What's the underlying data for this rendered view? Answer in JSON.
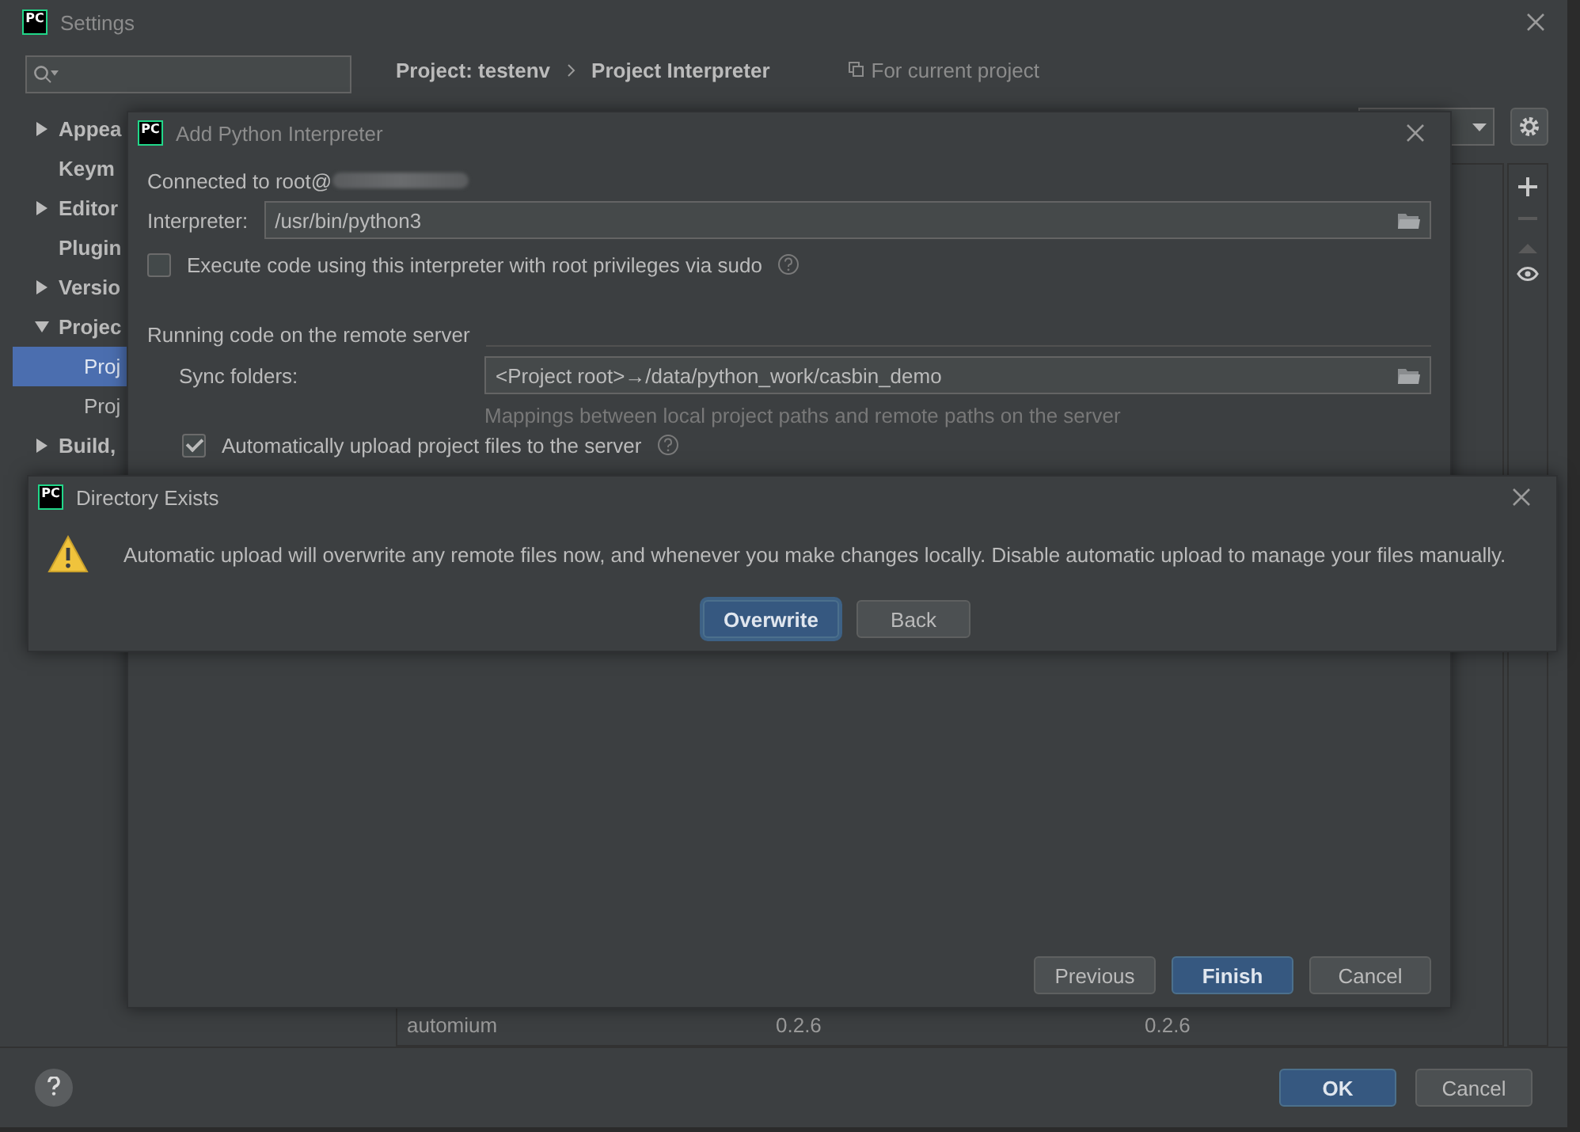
{
  "settings": {
    "logo": "PC",
    "title": "Settings",
    "breadcrumb": [
      "Project: testenv",
      "Project Interpreter"
    ],
    "scope_note": "For current project",
    "sidebar": {
      "items": [
        {
          "label": "Appea",
          "kind": "group",
          "expanded": false
        },
        {
          "label": "Keym",
          "kind": "leaf"
        },
        {
          "label": "Editor",
          "kind": "group",
          "expanded": false
        },
        {
          "label": "Plugin",
          "kind": "leaf"
        },
        {
          "label": "Versio",
          "kind": "group",
          "expanded": false
        },
        {
          "label": "Projec",
          "kind": "group",
          "expanded": true,
          "children": [
            {
              "label": "Proj",
              "selected": true
            },
            {
              "label": "Proj",
              "selected": false
            }
          ]
        },
        {
          "label": "Build,",
          "kind": "group",
          "expanded": false
        }
      ]
    },
    "packages_table": {
      "rows": [
        {
          "package": "automium",
          "version": "0.2.6",
          "latest": "0.2.6"
        }
      ]
    },
    "footer_buttons": [
      {
        "label": "OK",
        "primary": true
      },
      {
        "label": "Cancel",
        "primary": false
      }
    ]
  },
  "add_interpreter": {
    "logo": "PC",
    "title": "Add Python Interpreter",
    "connected": "Connected to root@",
    "interpreter_label": "Interpreter:",
    "interpreter_value": "/usr/bin/python3",
    "sudo": {
      "label": "Execute code using this interpreter with root privileges via sudo",
      "checked": false
    },
    "section": "Running code on the remote server",
    "sync_label": "Sync folders:",
    "sync_value": "<Project root>→/data/python_work/casbin_demo",
    "sync_hint": "Mappings between local project paths and remote paths on the server",
    "auto_upload": {
      "label": "Automatically upload project files to the server",
      "checked": true
    },
    "buttons": [
      {
        "label": "Previous",
        "primary": false
      },
      {
        "label": "Finish",
        "primary": true
      },
      {
        "label": "Cancel",
        "primary": false
      }
    ]
  },
  "directory_dialog": {
    "logo": "PC",
    "title": "Directory Exists",
    "message": "Automatic upload will overwrite any remote files now, and whenever you make changes locally. Disable automatic upload to manage your files manually.",
    "buttons": [
      {
        "label": "Overwrite",
        "primary": true
      },
      {
        "label": "Back",
        "primary": false
      }
    ]
  }
}
